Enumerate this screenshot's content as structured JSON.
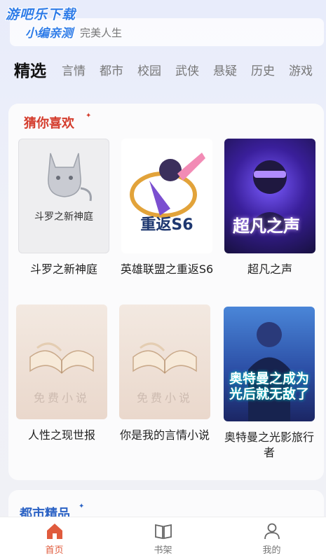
{
  "watermark": {
    "line1": "游吧乐下载",
    "line2": "小编亲测"
  },
  "search": {
    "text": "完美人生"
  },
  "tabs": [
    {
      "label": "精选",
      "active": true
    },
    {
      "label": "言情",
      "active": false
    },
    {
      "label": "都市",
      "active": false
    },
    {
      "label": "校园",
      "active": false
    },
    {
      "label": "武侠",
      "active": false
    },
    {
      "label": "悬疑",
      "active": false
    },
    {
      "label": "历史",
      "active": false
    },
    {
      "label": "游戏",
      "active": false
    }
  ],
  "sections": {
    "recommend": {
      "title": "猜你喜欢",
      "books": [
        {
          "title": "斗罗之新神庭",
          "cover_text": "斗罗之新神庭"
        },
        {
          "title": "英雄联盟之重返S6",
          "cover_text": "英雄联盟之重返S6"
        },
        {
          "title": "超凡之声",
          "cover_text": "超凡之声"
        },
        {
          "title": "人性之现世报",
          "cover_text": "免费小说"
        },
        {
          "title": "你是我的言情小说",
          "cover_text": "免费小说"
        },
        {
          "title": "奥特曼之光影旅行者",
          "cover_text": "奥特曼之成为光后就无敌了"
        }
      ]
    },
    "city": {
      "title": "都市精品"
    }
  },
  "bottom_nav": [
    {
      "label": "首页",
      "icon": "home-icon",
      "active": true
    },
    {
      "label": "书架",
      "icon": "book-icon",
      "active": false
    },
    {
      "label": "我的",
      "icon": "user-icon",
      "active": false
    }
  ],
  "colors": {
    "accent": "#e05b3d",
    "section_red": "#d43c2c",
    "section_blue": "#2c63c5"
  }
}
